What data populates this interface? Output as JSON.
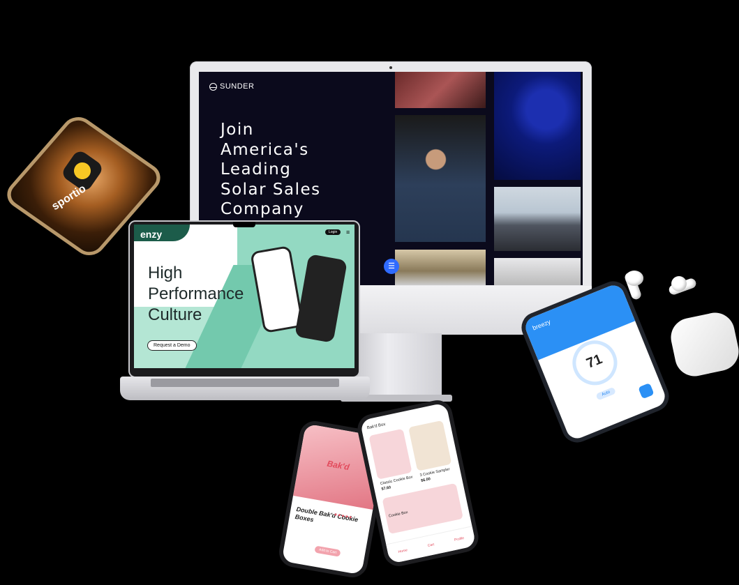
{
  "desktop": {
    "brand": "SUNDER",
    "headline": "Join\nAmerica's\nLeading\nSolar Sales\nCompany"
  },
  "laptop": {
    "brand": "enzy",
    "headline": "High\nPerformance\nCulture",
    "cta": "Request a Demo",
    "login": "Login"
  },
  "sportio": {
    "brand": "sportio"
  },
  "breezy": {
    "brand": "breezy",
    "temperature": "71",
    "mode": "Auto"
  },
  "bakd_detail": {
    "logo": "Bak'd",
    "product": "Double Bak'd Cookie Boxes",
    "cart": "Add to Cart"
  },
  "bakd_shop": {
    "header": "Bak'd Box",
    "item1": "Classic Cookie Box",
    "price1": "$7.60",
    "item2": "3 Cookie Sampler",
    "price2": "$6.00",
    "item3": "Cookie Box",
    "tabs": [
      "Home",
      "Cart",
      "Profile"
    ]
  },
  "colors": {
    "accent_blue": "#2f6bff",
    "mint": "#93d9c2",
    "bakd_pink": "#e24a5c",
    "breezy_blue": "#2b90f5"
  }
}
